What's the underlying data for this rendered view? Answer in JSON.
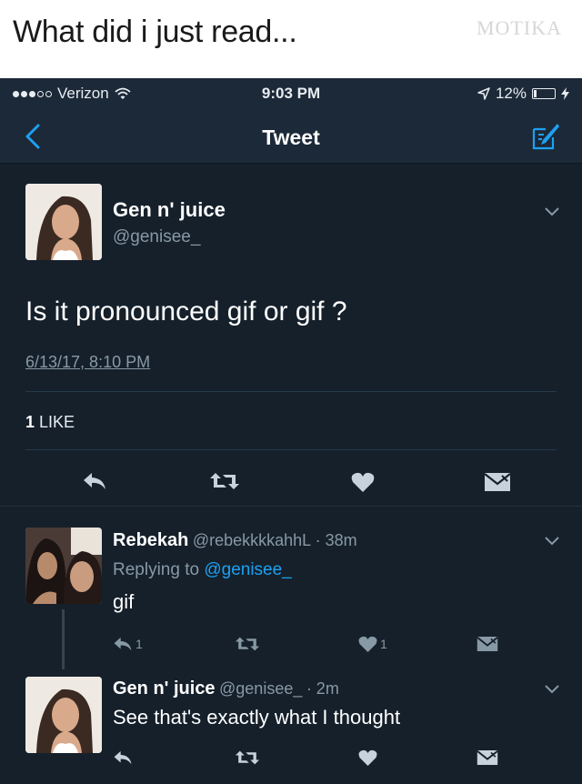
{
  "meme": {
    "caption": "What did i just read...",
    "watermark": "MOTIKA"
  },
  "status_bar": {
    "carrier": "Verizon",
    "time": "9:03 PM",
    "battery": "12%",
    "battery_level": 0.12
  },
  "nav": {
    "title": "Tweet"
  },
  "tweet": {
    "name": "Gen n' juice",
    "handle": "@genisee_",
    "text": "Is it pronounced gif or gif ?",
    "timestamp": "6/13/17, 8:10 PM",
    "likes_count": "1",
    "likes_label": "LIKE"
  },
  "replies": [
    {
      "name": "Rebekah",
      "handle": "@rebekkkkahhL",
      "time": "· 38m",
      "replying_label": "Replying to",
      "replying_to": "@genisee_",
      "text": "gif",
      "reply_count": "1",
      "like_count": "1"
    },
    {
      "name": "Gen n' juice",
      "handle": "@genisee_",
      "time": "· 2m",
      "text": "See that's exactly what I thought"
    }
  ],
  "colors": {
    "background": "#15202b",
    "nav": "#1c2938",
    "accent": "#1da1f2",
    "muted": "#8899a6"
  },
  "icons": [
    "back-chevron-icon",
    "compose-icon",
    "reply-icon",
    "retweet-icon",
    "heart-icon",
    "direct-message-icon",
    "chevron-down-icon",
    "wifi-icon",
    "location-arrow-icon",
    "battery-icon",
    "charging-bolt-icon"
  ]
}
